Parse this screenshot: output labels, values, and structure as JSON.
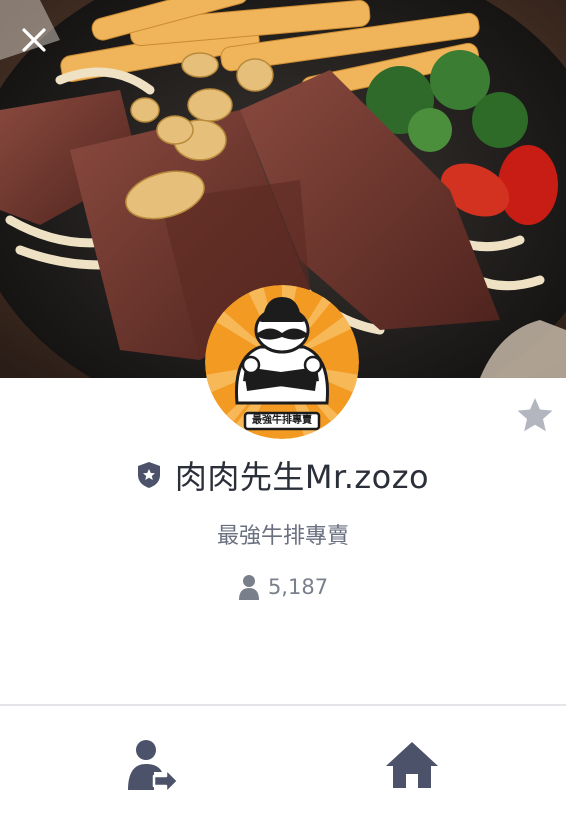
{
  "header": {
    "close_icon": "close-icon",
    "cover_image": "sizzling-steak-plate"
  },
  "profile": {
    "name": "肉肉先生Mr.zozo",
    "subtitle": "最強牛排專賣",
    "followers": "5,187",
    "logo_banner_text": "最強牛排專賣",
    "badge_icon": "shield-star-icon",
    "favorite_icon": "star-icon"
  },
  "bottom_bar": {
    "left_icon": "share-contact-icon",
    "right_icon": "home-icon"
  },
  "colors": {
    "text_dark": "#2b2f3a",
    "text_muted": "#6b7080",
    "icon_slate": "#4b5269",
    "star_gray": "#b3b6bf",
    "logo_orange": "#f39a23"
  }
}
